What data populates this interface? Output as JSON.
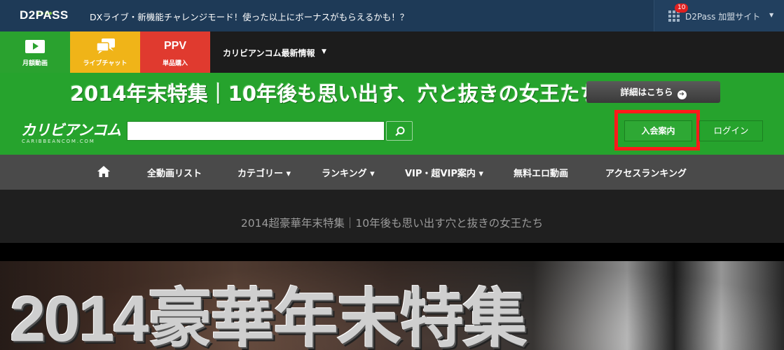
{
  "topbar": {
    "logo": "D2PASS",
    "message": "DXライブ・新機能チャレンジモード！使った以上にボーナスがもらえるかも！？",
    "badge_count": "10",
    "sites_label": "D2Pass 加盟サイト",
    "caret": "▼"
  },
  "nav": {
    "monthly_label": "月額動画",
    "live_label": "ライブチャット",
    "ppv_title": "PPV",
    "ppv_label": "単品購入",
    "news_label": "カリビアンコム最新情報",
    "news_caret": "▼"
  },
  "banner": {
    "headline": "2014年末特集｜10年後も思い出す、穴と抜きの女王たち",
    "detail_label": "詳細はこちら",
    "detail_arrow": "➔"
  },
  "site": {
    "logo": "カリビアンコム",
    "logo_sub": "CARIBBEANCOM.COM"
  },
  "search": {
    "value": "",
    "placeholder": ""
  },
  "account": {
    "join_label": "入会案内",
    "login_label": "ログイン"
  },
  "menu": {
    "items": [
      "全動画リスト",
      "カテゴリー ▾",
      "ランキング ▾",
      "VIP・超VIP案内 ▾",
      "無料エロ動画",
      "アクセスランキング"
    ]
  },
  "page": {
    "title": "2014超豪華年末特集｜10年後も思い出す穴と抜きの女王たち"
  },
  "hero": {
    "title": "2014豪華年末特集"
  },
  "colors": {
    "topbar": "#1e3a57",
    "green": "#26a32d",
    "live": "#f0b418",
    "ppv": "#e03a2f",
    "highlight": "#ff1a1a",
    "graynav": "#4a4a4a"
  }
}
